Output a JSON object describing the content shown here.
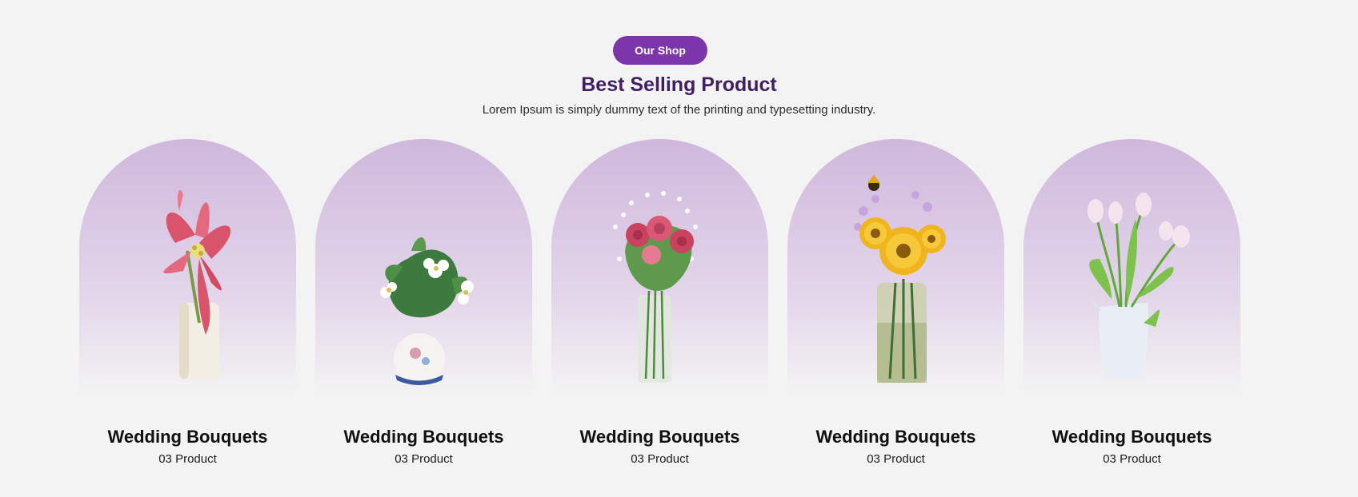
{
  "header": {
    "pill_label": "Our Shop",
    "title": "Best Selling Product",
    "subtitle": "Lorem Ipsum is simply dummy text of the printing and typesetting industry."
  },
  "colors": {
    "accent": "#7c35ab",
    "title": "#3e1f62",
    "arch_top": "#cfb8dc",
    "background": "#f3f3f3"
  },
  "products": [
    {
      "name": "Wedding Bouquets",
      "count": "03 Product",
      "image": "pink-lily-bouquet-image"
    },
    {
      "name": "Wedding Bouquets",
      "count": "03 Product",
      "image": "white-anemone-bouquet-image"
    },
    {
      "name": "Wedding Bouquets",
      "count": "03 Product",
      "image": "pink-rose-bouquet-image"
    },
    {
      "name": "Wedding Bouquets",
      "count": "03 Product",
      "image": "sunflower-bouquet-image"
    },
    {
      "name": "Wedding Bouquets",
      "count": "03 Product",
      "image": "white-tulip-bouquet-image"
    }
  ]
}
